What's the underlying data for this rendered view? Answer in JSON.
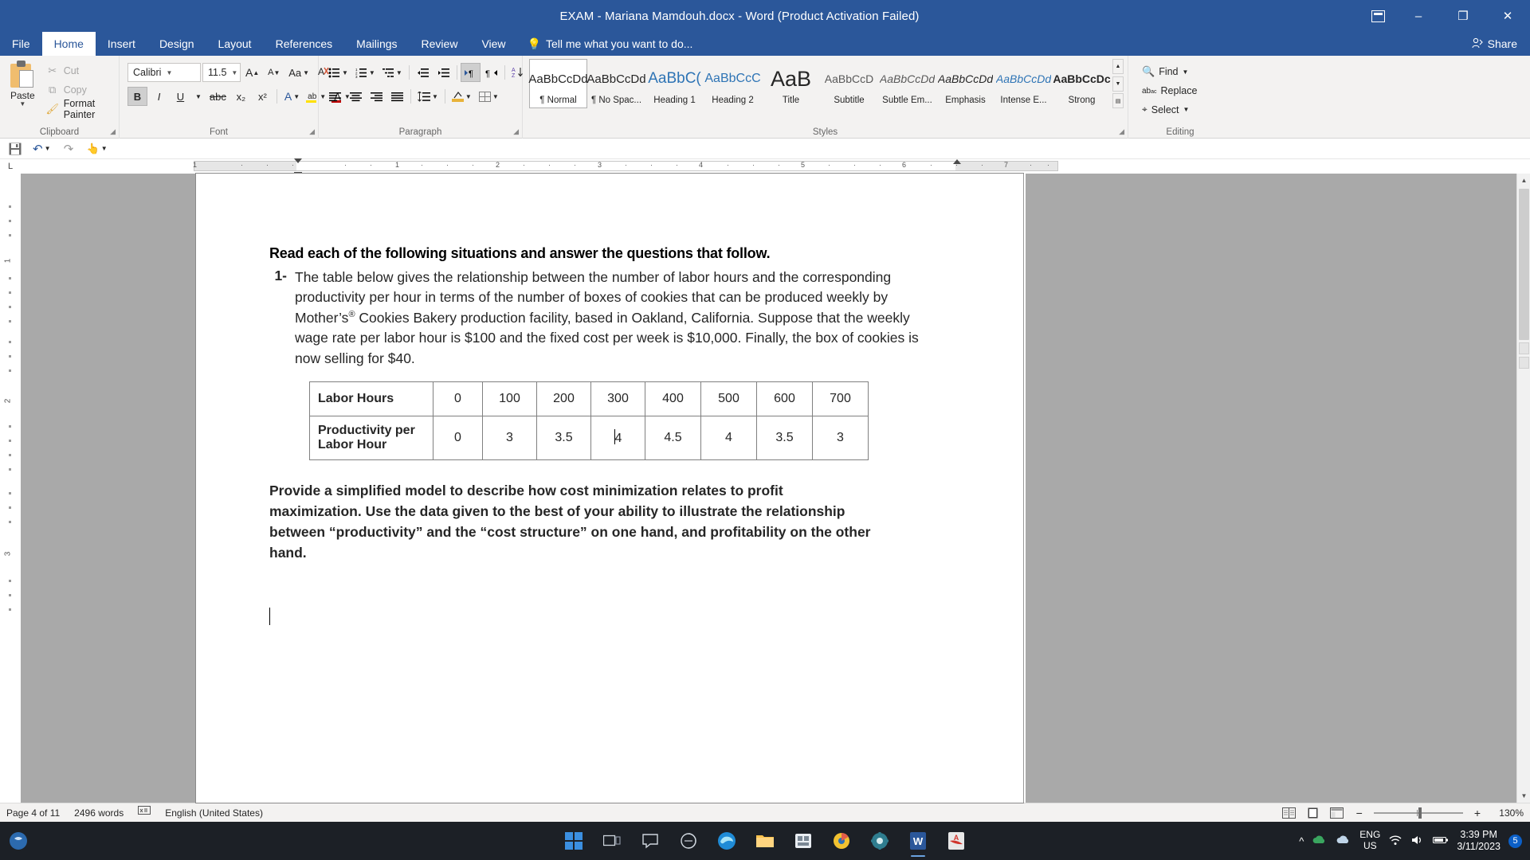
{
  "titlebar": {
    "title": "EXAM - Mariana Mamdouh.docx - Word (Product Activation Failed)",
    "ribbon_display_icon": "ribbon-display-options-icon",
    "minimize": "–",
    "restore": "❐",
    "close": "✕"
  },
  "tabs": [
    {
      "label": "File",
      "name": "tab-file"
    },
    {
      "label": "Home",
      "name": "tab-home"
    },
    {
      "label": "Insert",
      "name": "tab-insert"
    },
    {
      "label": "Design",
      "name": "tab-design"
    },
    {
      "label": "Layout",
      "name": "tab-layout"
    },
    {
      "label": "References",
      "name": "tab-references"
    },
    {
      "label": "Mailings",
      "name": "tab-mailings"
    },
    {
      "label": "Review",
      "name": "tab-review"
    },
    {
      "label": "View",
      "name": "tab-view"
    }
  ],
  "tellme": {
    "label": "Tell me what you want to do...",
    "icon": "lightbulb-icon"
  },
  "share": {
    "label": "Share",
    "icon": "share-person-icon"
  },
  "ribbon": {
    "clipboard": {
      "group_label": "Clipboard",
      "paste_label": "Paste",
      "cut_label": "Cut",
      "copy_label": "Copy",
      "format_painter_label": "Format Painter"
    },
    "font": {
      "group_label": "Font",
      "font_family": "Calibri",
      "font_size": "11.5",
      "grow_font": "A",
      "shrink_font": "A",
      "change_case": "Aa",
      "clear_formatting": "clear-formatting-icon",
      "bold": "B",
      "italic": "I",
      "underline": "U",
      "strikethrough": "abc",
      "subscript": "x₂",
      "superscript": "x²",
      "text_effects": "A",
      "highlight": "ab",
      "font_color": "A"
    },
    "paragraph": {
      "group_label": "Paragraph",
      "bullets": "bullets-icon",
      "numbering": "numbering-icon",
      "multilevel": "multilevel-list-icon",
      "decrease_indent": "decrease-indent-icon",
      "increase_indent": "increase-indent-icon",
      "ltr": "left-to-right-icon",
      "rtl": "right-to-left-icon",
      "sort": "sort-icon",
      "show_marks": "¶",
      "align_left": "align-left-icon",
      "align_center": "align-center-icon",
      "align_right": "align-right-icon",
      "justify": "justify-icon",
      "line_spacing": "line-spacing-icon",
      "shading": "shading-icon",
      "borders": "borders-icon"
    },
    "styles": {
      "group_label": "Styles",
      "items": [
        {
          "preview": "AaBbCcDd",
          "name": "Normal",
          "prefix": "¶",
          "selected": true
        },
        {
          "preview": "AaBbCcDd",
          "name": "No Spac...",
          "prefix": "¶",
          "selected": false
        },
        {
          "preview": "AaBbC(",
          "name": "Heading 1",
          "prefix": "",
          "selected": false
        },
        {
          "preview": "AaBbCcC",
          "name": "Heading 2",
          "prefix": "",
          "selected": false
        },
        {
          "preview": "AaB",
          "name": "Title",
          "prefix": "",
          "selected": false
        },
        {
          "preview": "AaBbCcD",
          "name": "Subtitle",
          "prefix": "",
          "selected": false
        },
        {
          "preview": "AaBbCcDd",
          "name": "Subtle Em...",
          "prefix": "",
          "selected": false
        },
        {
          "preview": "AaBbCcDd",
          "name": "Emphasis",
          "prefix": "",
          "selected": false
        },
        {
          "preview": "AaBbCcDd",
          "name": "Intense E...",
          "prefix": "",
          "selected": false
        },
        {
          "preview": "AaBbCcDc",
          "name": "Strong",
          "prefix": "",
          "selected": false
        }
      ]
    },
    "editing": {
      "group_label": "Editing",
      "find_label": "Find",
      "replace_label": "Replace",
      "select_label": "Select"
    }
  },
  "quick_access": {
    "save": "save-icon",
    "undo": "undo-icon",
    "redo": "redo-icon",
    "touch": "touch-mode-icon"
  },
  "ruler": {
    "marks": [
      "1",
      "1",
      "2",
      "3",
      "4",
      "5",
      "6",
      "7"
    ]
  },
  "document": {
    "heading": "Read each of the following situations and answer the questions that follow.",
    "question_number": "1-",
    "question_text": "The table below gives the relationship between the number of labor hours and the corresponding productivity per hour in terms of the number of boxes of cookies that can be produced weekly by Mother’s® Cookies Bakery production facility, based in Oakland, California. Suppose that the weekly wage rate per labor hour is $100 and the fixed cost per week is $10,000. Finally, the box of cookies is now selling for $40.",
    "table": {
      "row_headers": [
        "Labor Hours",
        "Productivity per Labor Hour"
      ],
      "labor_hours": [
        "0",
        "100",
        "200",
        "300",
        "400",
        "500",
        "600",
        "700"
      ],
      "productivity": [
        "0",
        "3",
        "3.5",
        "4",
        "4.5",
        "4",
        "3.5",
        "3"
      ],
      "caret_cell_index": 3
    },
    "closing_paragraph": "Provide a simplified model to describe how cost minimization relates to profit maximization. Use the data given to the best of your ability to illustrate the relationship between “productivity” and the “cost structure” on one hand, and profitability on the other hand."
  },
  "status_bar": {
    "page": "Page 4 of 11",
    "words": "2496 words",
    "proofing_icon": "proofing-errors-icon",
    "language": "English (United States)",
    "view_read": "read-mode-icon",
    "view_print": "print-layout-icon",
    "view_web": "web-layout-icon",
    "zoom_out": "−",
    "zoom_in": "+",
    "zoom_level": "130%"
  },
  "taskbar": {
    "start": "windows-start-icon",
    "apps": [
      {
        "name": "task-view-icon",
        "glyph": "❐"
      },
      {
        "name": "chat-icon",
        "glyph": "💬"
      },
      {
        "name": "widgets-icon",
        "glyph": "◎"
      },
      {
        "name": "edge-icon",
        "glyph": "e"
      },
      {
        "name": "file-explorer-icon",
        "glyph": "🗀"
      },
      {
        "name": "store-icon",
        "glyph": "▤"
      },
      {
        "name": "browser-icon",
        "glyph": "◉"
      },
      {
        "name": "settings-icon",
        "glyph": "⚙"
      },
      {
        "name": "word-icon",
        "glyph": "W"
      },
      {
        "name": "acrobat-icon",
        "glyph": "A"
      }
    ],
    "show_hidden": "^",
    "onedrive": "onedrive-icon",
    "cloud": "cloud-icon",
    "language": "ENG",
    "language_sub": "US",
    "wifi": "wifi-icon",
    "volume": "volume-icon",
    "battery": "battery-icon",
    "time": "3:39 PM",
    "date": "3/11/2023",
    "notification_count": "5"
  },
  "colors": {
    "word_blue": "#2b579a",
    "ribbon_bg": "#f3f2f1",
    "accent_text": "#2b579a"
  }
}
